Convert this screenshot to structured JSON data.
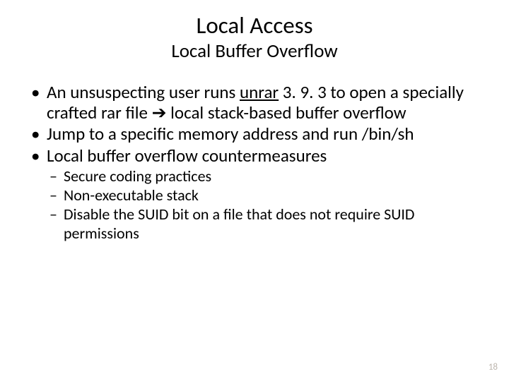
{
  "title": "Local Access",
  "subtitle": "Local Buffer Overflow",
  "bullets": [
    {
      "pre": "An unsuspecting user runs ",
      "underlined": "unrar",
      "mid": " 3. 9. 3 to open a specially crafted rar file ",
      "arrow": "➔",
      "post": " local stack-based buffer overflow"
    },
    {
      "text": "Jump to a specific memory address and run /bin/sh"
    },
    {
      "text": "Local buffer overflow countermeasures"
    }
  ],
  "sub_bullets": [
    "Secure coding practices",
    "Non-executable stack",
    "Disable the SUID bit on a file that does not require SUID permissions"
  ],
  "page_number": "18"
}
